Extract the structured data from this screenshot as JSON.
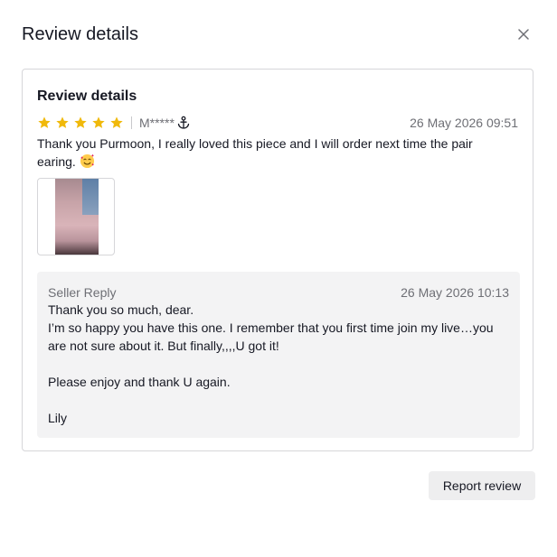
{
  "dialog": {
    "title": "Review details",
    "close_icon": "close-icon"
  },
  "review": {
    "heading": "Review details",
    "rating": 5,
    "rating_max": 5,
    "star_color": "#f0b90b",
    "reviewer": "M*****",
    "reviewer_badge_icon": "anchor-icon",
    "date": "26 May 2026 09:51",
    "text": "Thank you Purmoon, I really loved this piece and I will order next time the pair earing.",
    "emoji_icon": "smiling-face-with-hearts-emoji",
    "photo_icon": "review-photo"
  },
  "seller_reply": {
    "label": "Seller Reply",
    "date": "26 May 2026 10:13",
    "text": "Thank you so much, dear.\nI’m so happy you have this one. I remember that you first time join my live…you are not sure about it. But finally,,,,U got it!\n\nPlease enjoy and thank U again.\n\nLily"
  },
  "actions": {
    "report_label": "Report review"
  }
}
